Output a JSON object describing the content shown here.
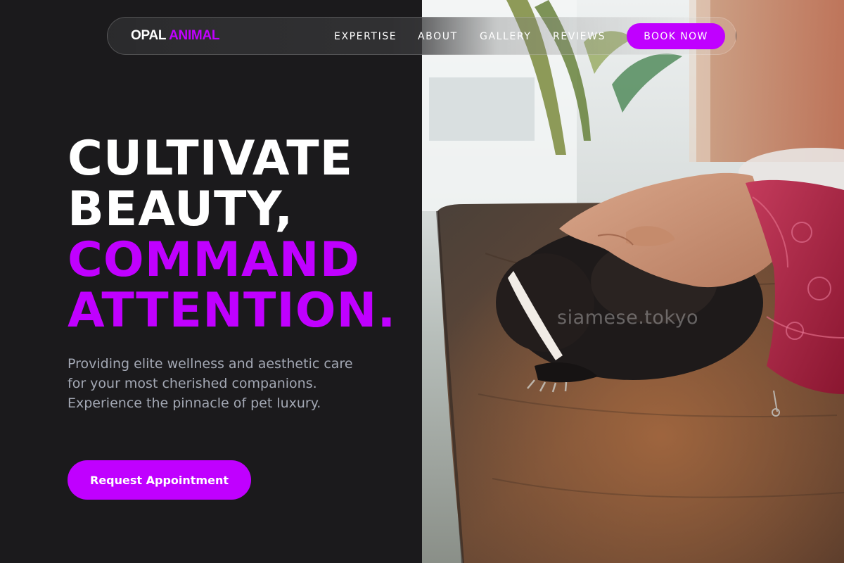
{
  "brand": {
    "name_part1": "OPAL",
    "name_part2": "ANIMAL",
    "accent_color": "#c000ff"
  },
  "nav": {
    "links": [
      "EXPERTISE",
      "ABOUT",
      "GALLERY",
      "REVIEWS"
    ],
    "cta_label": "BOOK NOW"
  },
  "hero": {
    "headline_white": [
      "CULTIVATE",
      "BEAUTY,"
    ],
    "headline_accent": [
      "COMMAND",
      "ATTENTION."
    ],
    "description": "Providing elite wellness and aesthetic care for your most cherished companions. Experience the pinnacle of pet luxury.",
    "cta_label": "Request Appointment"
  },
  "photo": {
    "watermark": "siamese.tokyo",
    "icon": "photo-skunk-petted-on-table"
  },
  "colors": {
    "background": "#1b1a1c",
    "accent": "#c000ff",
    "text_muted": "#a3a8b4"
  }
}
